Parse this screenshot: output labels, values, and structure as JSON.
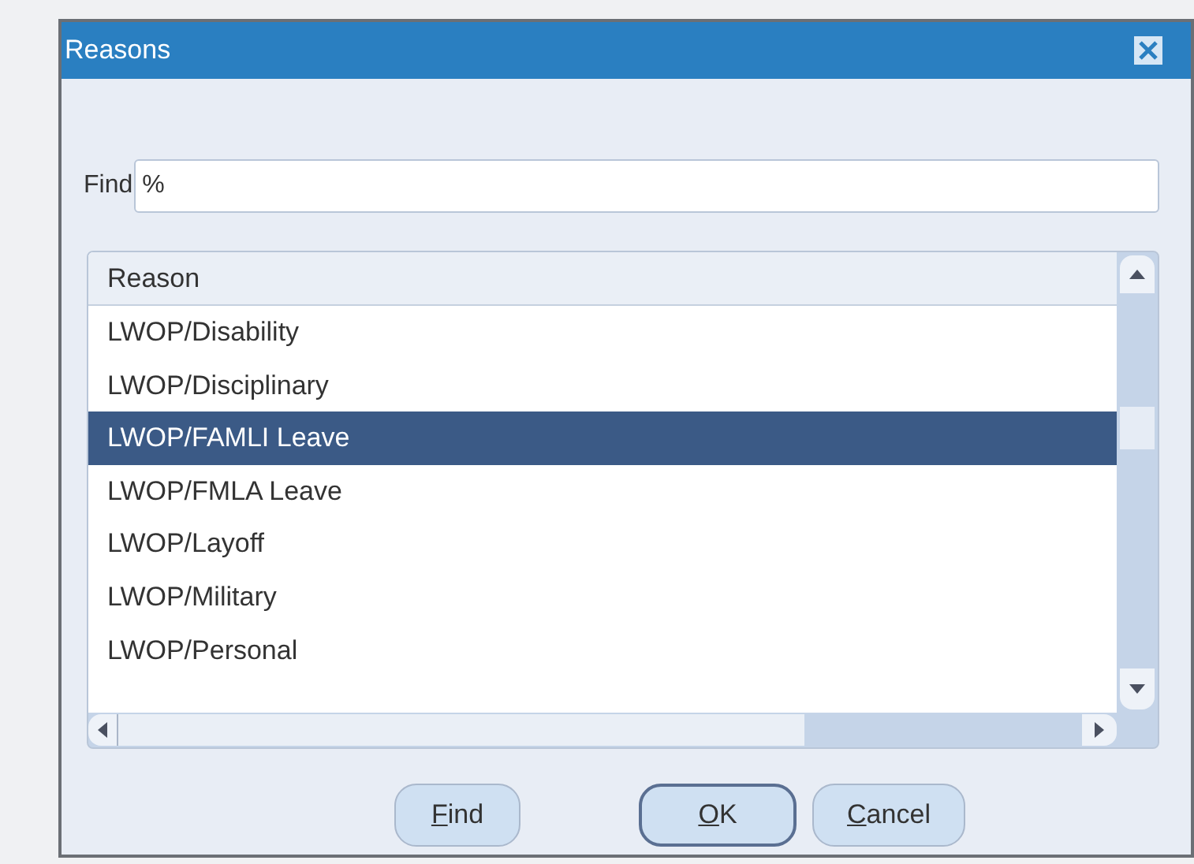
{
  "window": {
    "title": "Reasons"
  },
  "find_field": {
    "label": "Find",
    "value": "%"
  },
  "list": {
    "column": "Reason",
    "rows": [
      {
        "text": "LWOP/Disability",
        "selected": false
      },
      {
        "text": "LWOP/Disciplinary",
        "selected": false
      },
      {
        "text": "LWOP/FAMLI Leave",
        "selected": true
      },
      {
        "text": "LWOP/FMLA Leave",
        "selected": false
      },
      {
        "text": "LWOP/Layoff",
        "selected": false
      },
      {
        "text": "LWOP/Military",
        "selected": false
      },
      {
        "text": "LWOP/Personal",
        "selected": false
      }
    ]
  },
  "buttons": [
    {
      "label": "Find",
      "default": false
    },
    {
      "label": "OK",
      "default": true
    },
    {
      "label": "Cancel",
      "default": false
    }
  ]
}
